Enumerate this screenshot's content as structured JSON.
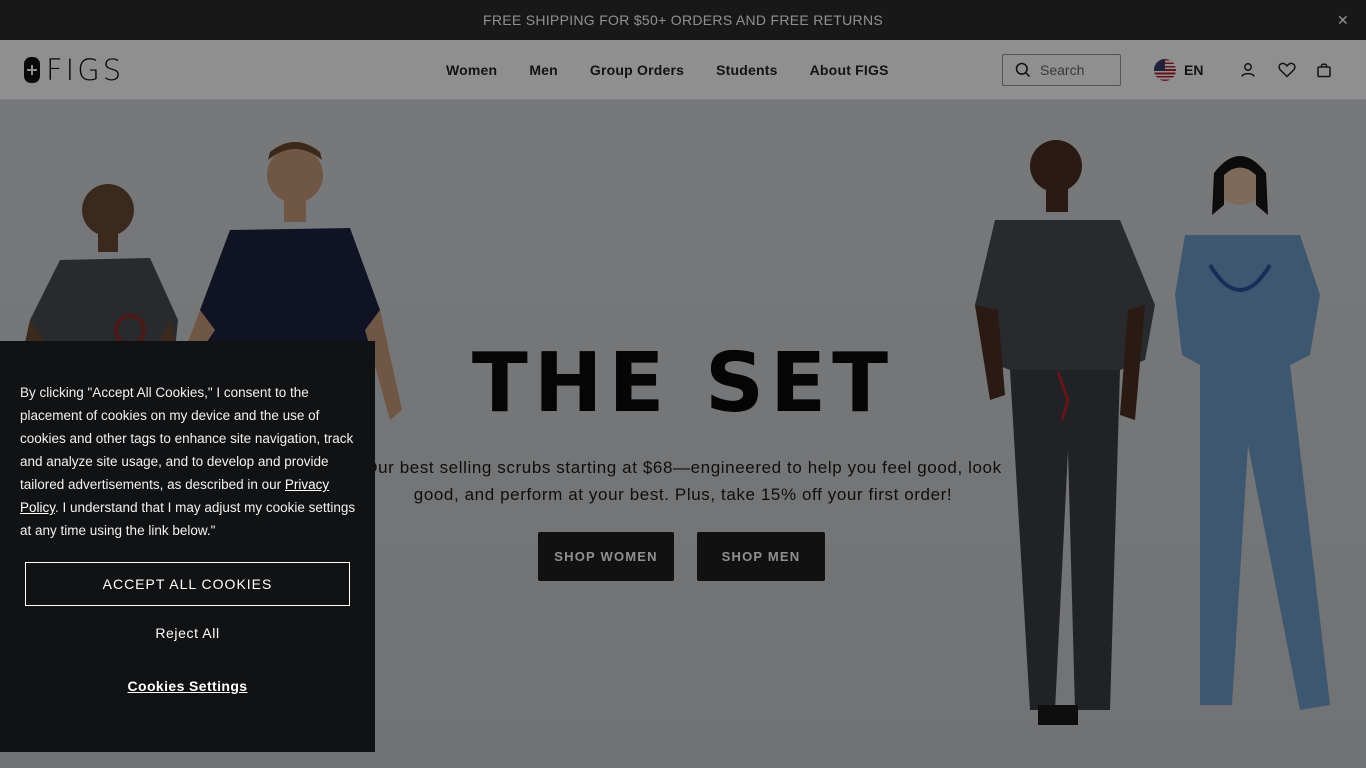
{
  "announcement": {
    "text": "FREE SHIPPING FOR $50+ ORDERS AND FREE RETURNS",
    "close_icon": "close-icon"
  },
  "header": {
    "logo_text": "FIGS",
    "nav": [
      "Women",
      "Men",
      "Group Orders",
      "Students",
      "About FIGS"
    ],
    "search_placeholder": "Search",
    "language": "EN",
    "icons": [
      "search-icon",
      "us-flag-icon",
      "account-icon",
      "wishlist-heart-icon",
      "bag-icon"
    ]
  },
  "hero": {
    "title": "THE SET",
    "subtitle": "Our best selling scrubs starting at $68—engineered to help you feel good, look good, and perform at your best. Plus, take 15% off your first order!",
    "buttons": [
      "SHOP WOMEN",
      "SHOP MEN"
    ]
  },
  "cookie_banner": {
    "text_before_link": "By clicking \"Accept All Cookies,\" I consent to the placement of cookies on my device and the use of cookies and other tags to enhance site navigation, track and analyze site usage, and to develop and provide tailored advertisements, as described in our ",
    "link_text": "Privacy Policy",
    "text_after_link": ". I understand that I may adjust my cookie settings at any time using the link below.\"",
    "accept_label": "ACCEPT ALL COOKIES",
    "reject_label": "Reject All",
    "settings_label": "Cookies Settings"
  },
  "colors": {
    "announcement_bg": "#2b2b2b",
    "button_bg": "#1f1f1f",
    "cookie_bg": "#111214",
    "scrub_charcoal": "#4a4b50",
    "scrub_navy": "#1d2240",
    "scrub_ceil_blue": "#6f9cc9"
  }
}
